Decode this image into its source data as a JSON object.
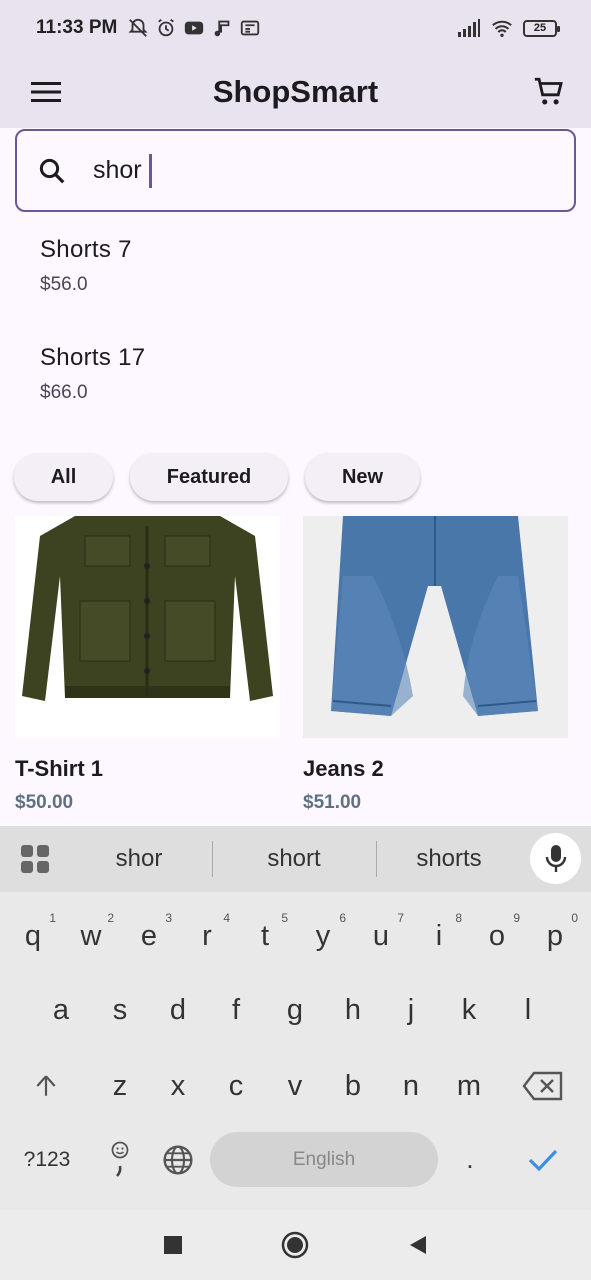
{
  "status": {
    "time": "11:33 PM",
    "battery": "25"
  },
  "app": {
    "title": "ShopSmart"
  },
  "search": {
    "query": "shor"
  },
  "suggestions": [
    {
      "name": "Shorts 7",
      "price": "$56.0"
    },
    {
      "name": "Shorts 17",
      "price": "$66.0"
    }
  ],
  "chips": [
    "All",
    "Featured",
    "New"
  ],
  "products": [
    {
      "name": "T-Shirt 1",
      "price": "$50.00"
    },
    {
      "name": "Jeans 2",
      "price": "$51.00"
    }
  ],
  "keyboard": {
    "word_suggestions": [
      "shor",
      "short",
      "shorts"
    ],
    "row1": [
      "q",
      "w",
      "e",
      "r",
      "t",
      "y",
      "u",
      "i",
      "o",
      "p"
    ],
    "row1_hints": [
      "1",
      "2",
      "3",
      "4",
      "5",
      "6",
      "7",
      "8",
      "9",
      "0"
    ],
    "row2": [
      "a",
      "s",
      "d",
      "f",
      "g",
      "h",
      "j",
      "k",
      "l"
    ],
    "row3": [
      "z",
      "x",
      "c",
      "v",
      "b",
      "n",
      "m"
    ],
    "symbols_label": "?123",
    "space_label": "English",
    "period_label": "."
  },
  "colors": {
    "accent": "#6a5796",
    "app_bar": "#e9e2ef",
    "price": "#5e7181",
    "check": "#3d8ee0"
  }
}
